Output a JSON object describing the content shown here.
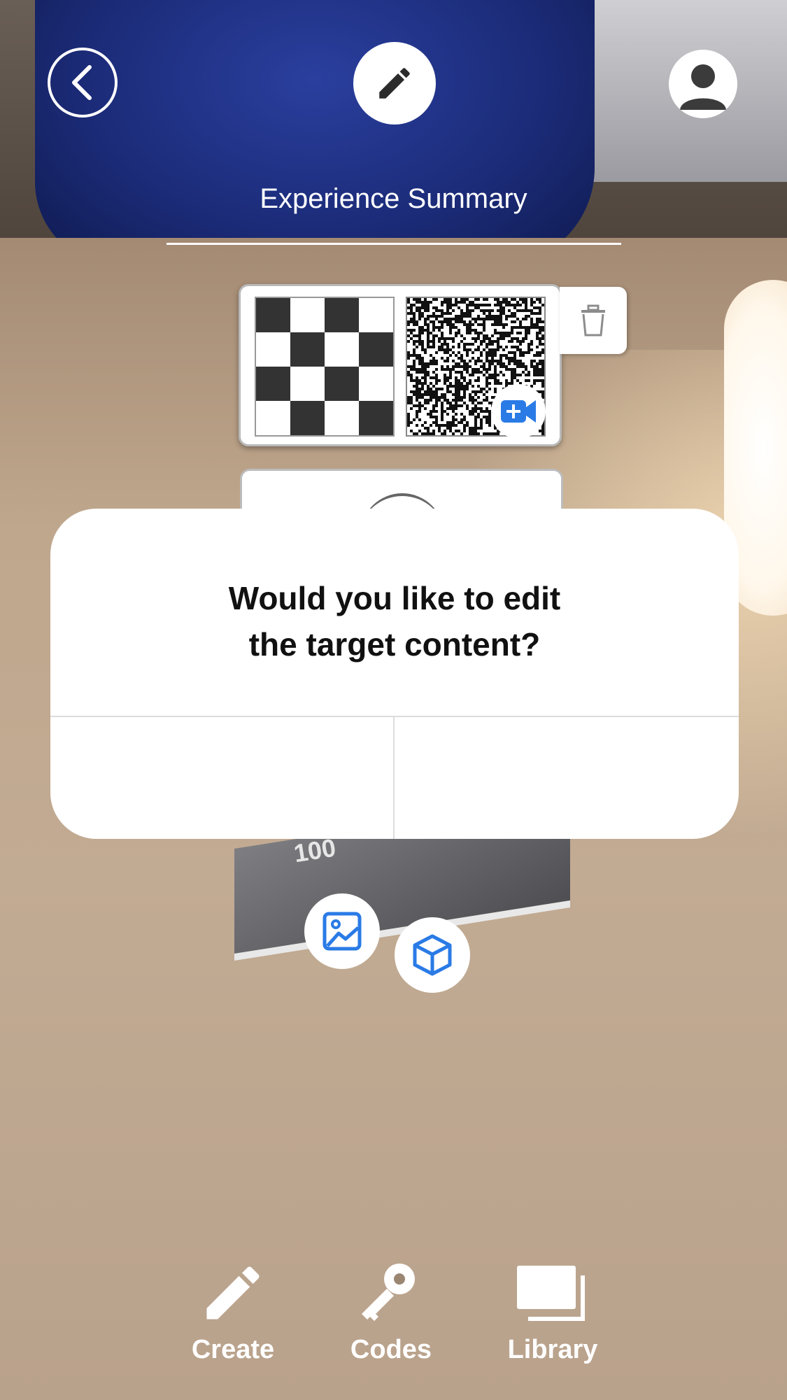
{
  "header": {
    "back_icon": "chevron-left-icon",
    "edit_icon": "pencil-icon",
    "profile_icon": "user-icon",
    "title": "Experience Summary"
  },
  "target": {
    "icons": [
      "checkerboard-target-image",
      "qr-target-image",
      "video-camera-add-icon",
      "trash-icon"
    ]
  },
  "dialog": {
    "message_line1": "Would you like to edit",
    "message_line2": "the target content?",
    "left_button_label": "",
    "right_button_label": ""
  },
  "background": {
    "box_number": "100"
  },
  "floating_actions": {
    "image_icon": "image-icon",
    "model_icon": "cube-icon"
  },
  "bottom_nav": {
    "items": [
      {
        "label": "Create",
        "icon": "pencil-icon"
      },
      {
        "label": "Codes",
        "icon": "key-icon"
      },
      {
        "label": "Library",
        "icon": "stacked-cards-icon"
      }
    ]
  },
  "colors": {
    "accent": "#2a7be6",
    "dialog_background": "#ffffff"
  }
}
